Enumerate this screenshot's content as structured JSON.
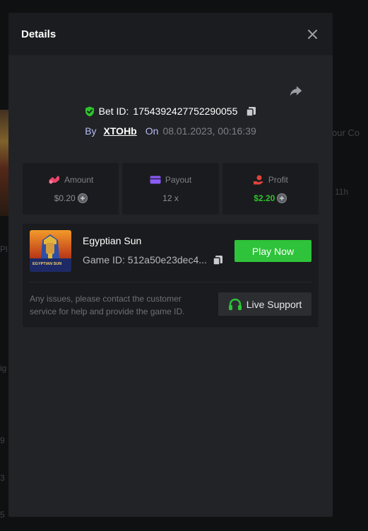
{
  "modal": {
    "title": "Details"
  },
  "bet": {
    "id_label": "Bet ID:",
    "id": "1754392427752290055",
    "by_label": "By",
    "username": "XTOHb",
    "on_label": "On",
    "datetime": "08.01.2023, 00:16:39"
  },
  "stats": {
    "amount_label": "Amount",
    "amount_value": "$0.20",
    "payout_label": "Payout",
    "payout_value": "12 x",
    "profit_label": "Profit",
    "profit_value": "$2.20"
  },
  "game": {
    "name": "Egyptian Sun",
    "id_label": "Game ID:",
    "id": "512a50e23dec4...",
    "thumb_text": "EGYPTIAN SUN",
    "play_label": "Play Now",
    "issue_text": "Any issues, please contact the customer service for help and provide the game ID.",
    "support_label": "Live Support"
  },
  "background": {
    "right_text": "our Co",
    "time_text": "11h",
    "left_pl": "Pl",
    "left_ig": "ig",
    "left_9": "9",
    "left_3": "3",
    "left_5": "5"
  },
  "colors": {
    "accent_green": "#2ec33a",
    "profit_green": "#2dc22d",
    "shield_green": "#2dc22d",
    "payout_purple": "#8b5cf6",
    "profit_red": "#e0443c",
    "amount_pink": "#e8466b"
  }
}
